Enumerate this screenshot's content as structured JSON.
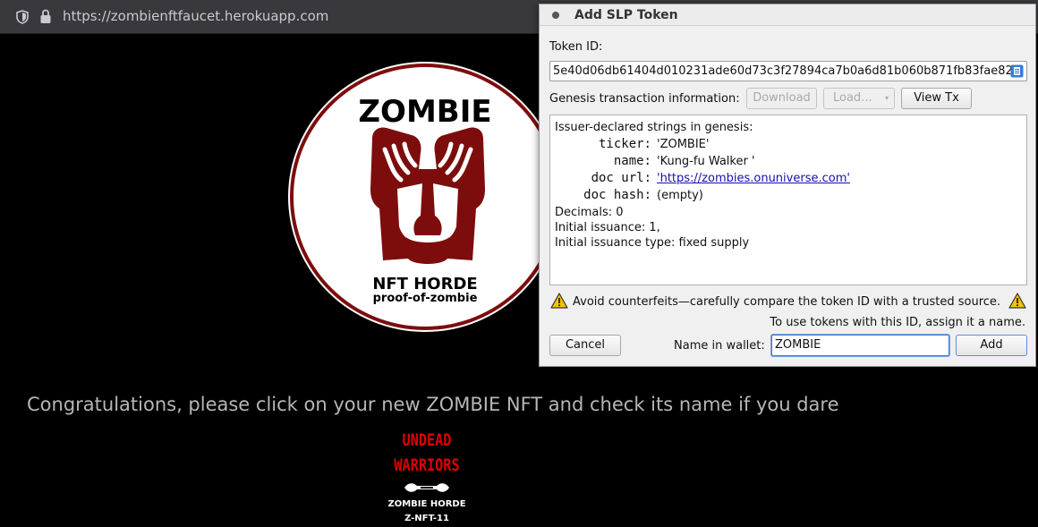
{
  "browser": {
    "url": "https://zombienftfaucet.herokuapp.com"
  },
  "page": {
    "logo": {
      "title": "ZOMBIE",
      "subtitle": "NFT HORDE",
      "tagline": "proof-of-zombie"
    },
    "congrats_text": "Congratulations, please click on your new ZOMBIE NFT and check its name if you dare",
    "badge": {
      "line1": "UNDEAD",
      "line2": "WARRIORS",
      "line3": "ZOMBIE HORDE",
      "line4": "Z-NFT-11"
    }
  },
  "dialog": {
    "title": "Add SLP Token",
    "token_id_label": "Token ID:",
    "token_id_value": "5e40d06db61404d010231ade60d73c3f27894ca7b0a6d81b060b871fb83fae82",
    "genesis_label": "Genesis transaction information:",
    "download_label": "Download",
    "load_label": "Load...",
    "view_tx_label": "View Tx",
    "info": {
      "heading": "Issuer-declared strings in genesis:",
      "ticker_key": "ticker:",
      "ticker_value": "'ZOMBIE'",
      "name_key": "name:",
      "name_value": "'Kung-fu Walker '",
      "doc_url_key": "doc url:",
      "doc_url_value": "'https://zombies.onuniverse.com'",
      "doc_hash_key": "doc hash:",
      "doc_hash_value": "(empty)",
      "decimals": "Decimals: 0",
      "initial_issuance": "Initial issuance: 1,",
      "issuance_type": "Initial issuance type: fixed supply"
    },
    "warning": "Avoid counterfeits—carefully compare the token ID with a trusted source.",
    "assign_hint": "To use tokens with this ID, assign it a name.",
    "cancel_label": "Cancel",
    "name_label": "Name in wallet:",
    "name_value": "ZOMBIE",
    "add_label": "Add"
  },
  "colors": {
    "logo_red": "#7d0d0d",
    "badge_red": "#e00000",
    "warning_yellow": "#f2c200"
  }
}
